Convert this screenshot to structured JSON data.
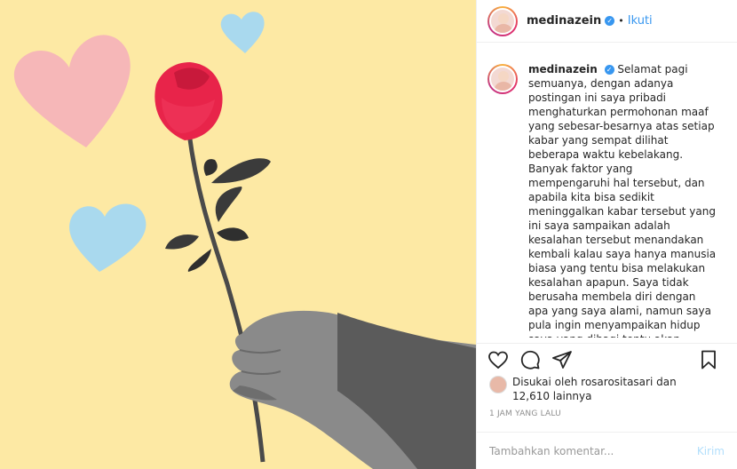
{
  "header": {
    "username": "medinazein",
    "follow_label": "Ikuti",
    "separator": "•"
  },
  "caption": {
    "username": "medinazein",
    "text": "Selamat pagi semuanya, dengan adanya postingan ini saya pribadi menghaturkan permohonan maaf yang sebesar-besarnya atas setiap kabar yang sempat dilihat beberapa waktu kebelakang. Banyak faktor yang mempengaruhi hal tersebut, dan apabila kita bisa sedikit meninggalkan kabar tersebut yang ini saya sampaikan adalah kesalahan tersebut menandakan kembali kalau saya hanya manusia biasa yang tentu bisa melakukan kesalahan apapun. Saya tidak berusaha membela diri dengan apa yang saya alami, namun saya pula ingin menyampaikan hidup saya yang dibagi tentu akan membentuk"
  },
  "likes": {
    "line1": "Disukai oleh rosarositasari dan",
    "line2": "12,610 lainnya"
  },
  "time_label": "1 JAM YANG LALU",
  "comment_box": {
    "placeholder": "Tambahkan komentar...",
    "send_label": "Kirim"
  },
  "icons": {
    "like": "heart-icon",
    "comment": "comment-icon",
    "share": "share-icon",
    "save": "bookmark-icon",
    "verified": "verified-badge-icon"
  },
  "colors": {
    "background_image": "#fde9a4",
    "link_blue": "#3897f0",
    "send_disabled": "#b2dffc",
    "rose_red": "#e8244a",
    "heart_pink": "#f6b7b8",
    "heart_blue": "#a9d9ee"
  }
}
